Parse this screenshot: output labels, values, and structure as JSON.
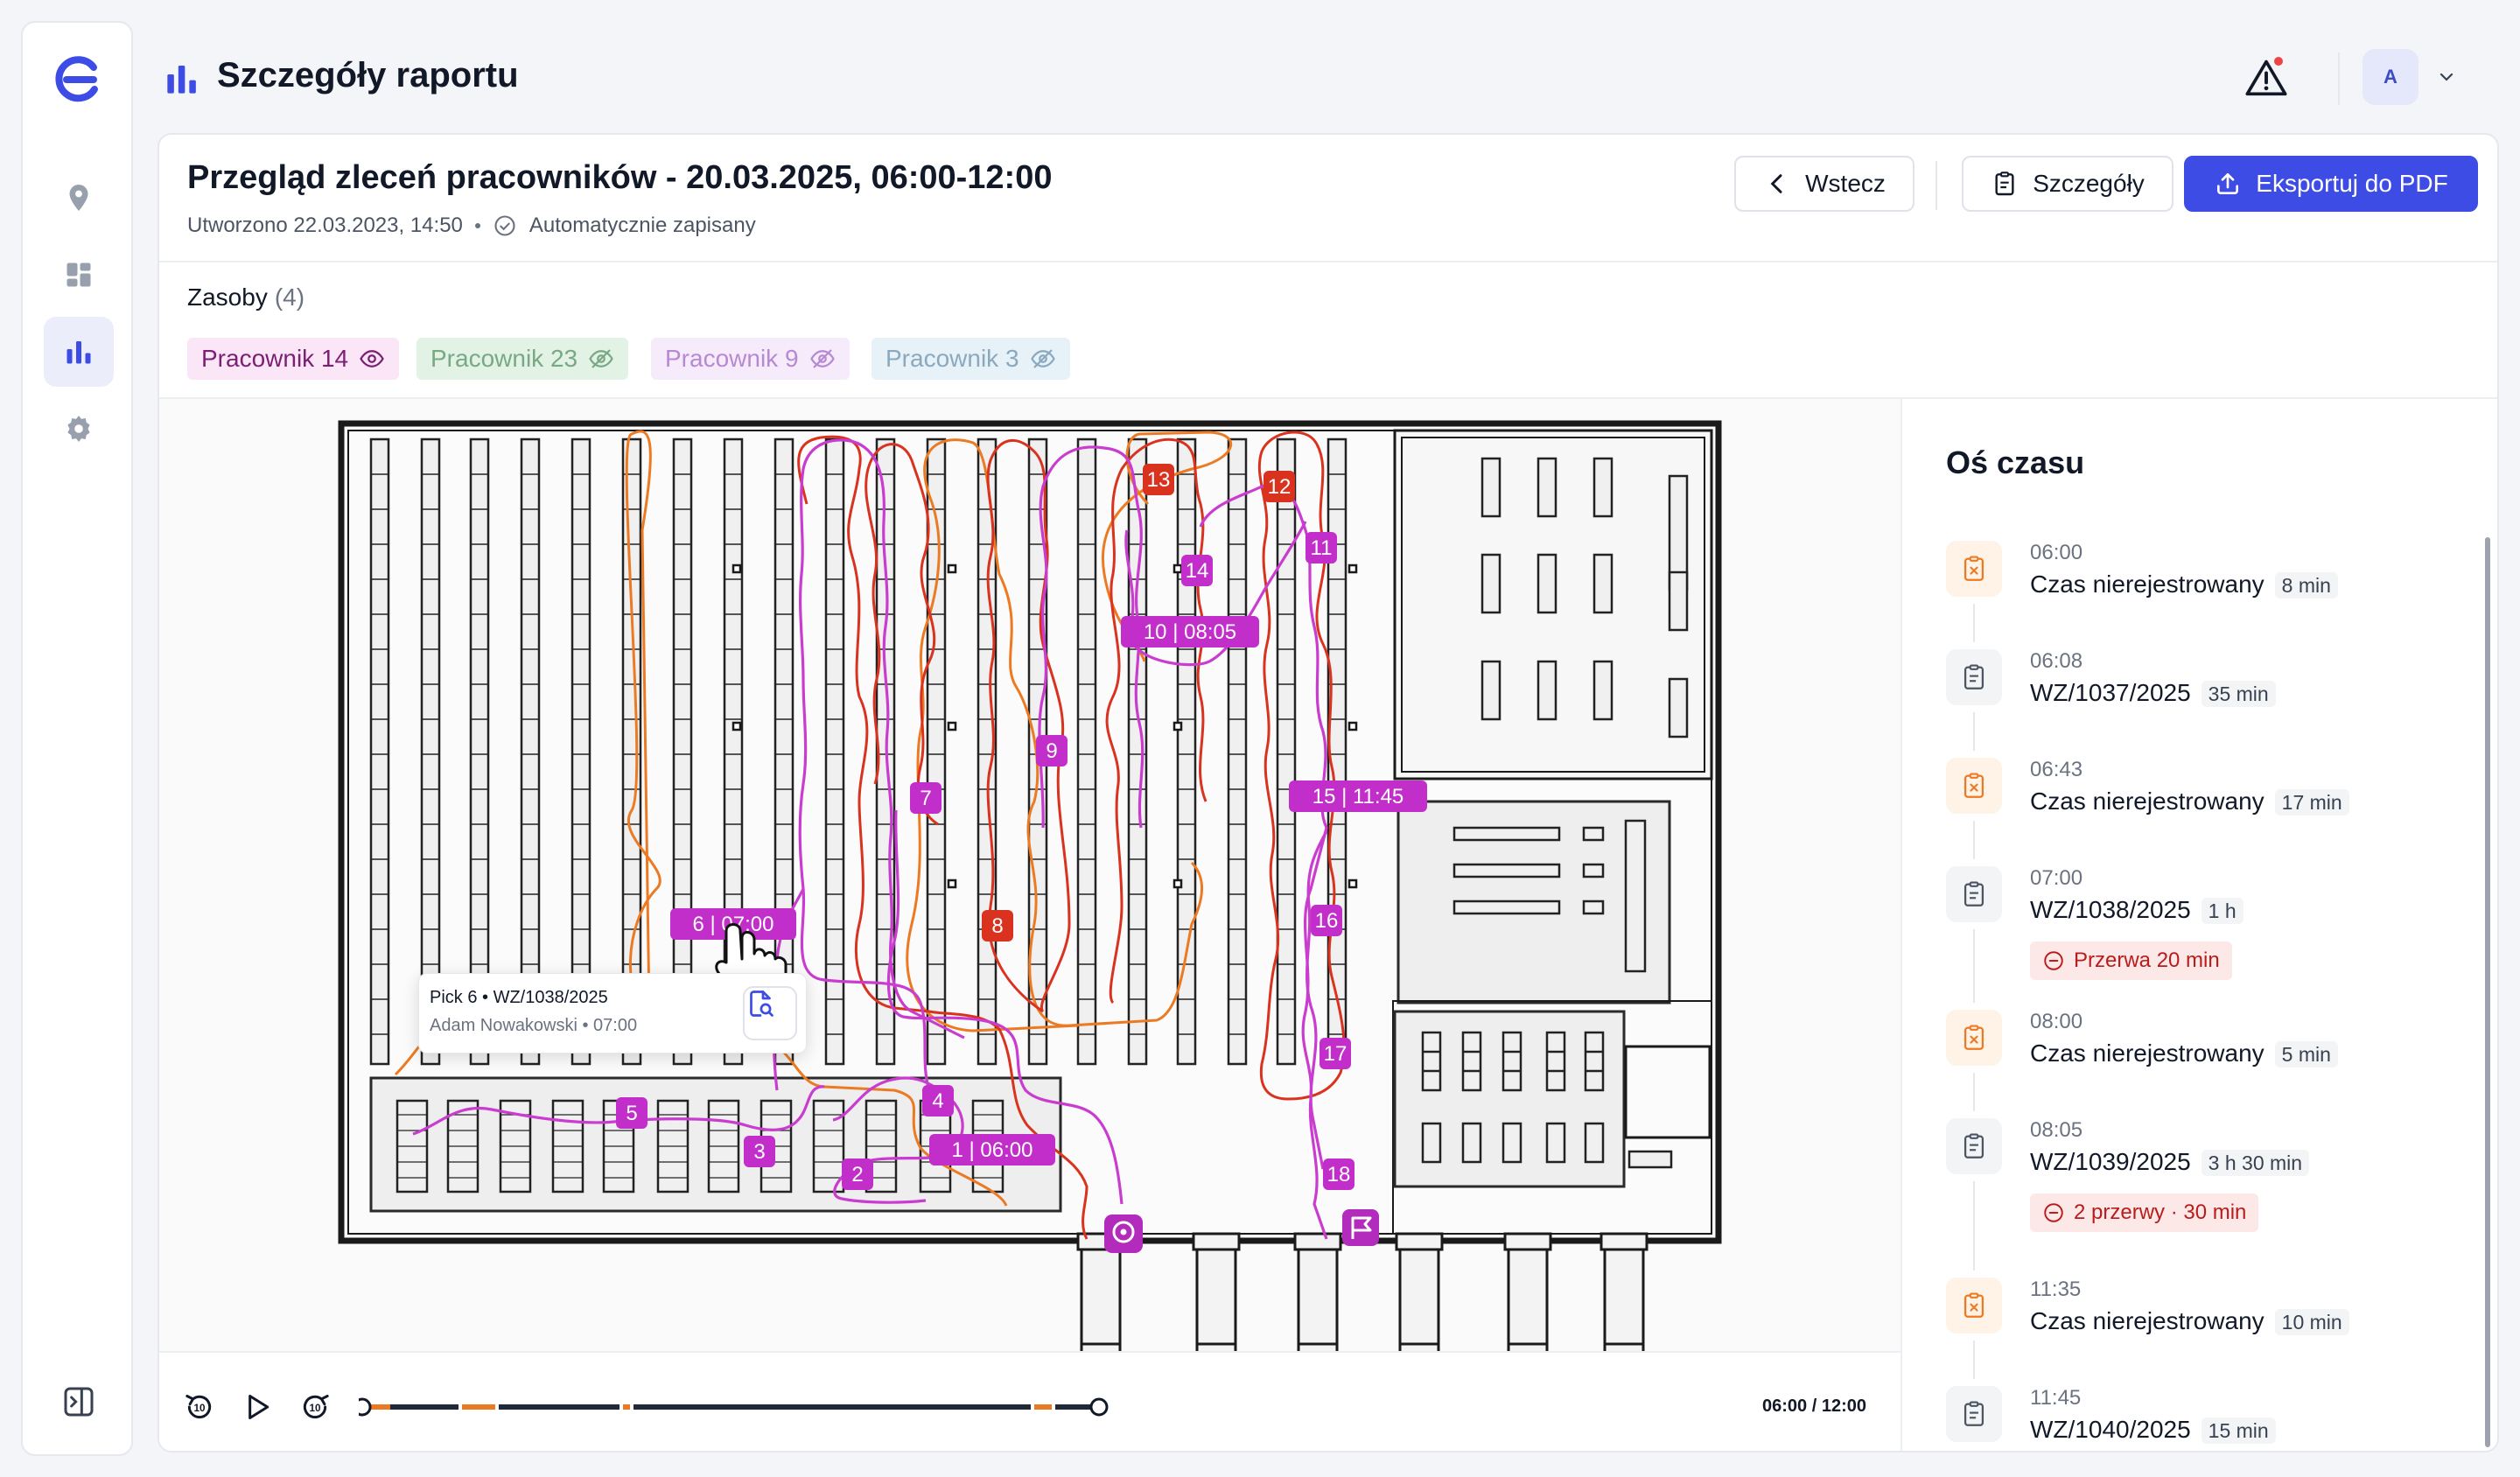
{
  "app": {
    "page_title": "Szczegóły raportu",
    "avatar_letter": "A",
    "brand_color": "#3d4ce4"
  },
  "sidebar": {
    "items": [
      {
        "icon": "location-pin-icon",
        "active": false
      },
      {
        "icon": "dashboard-grid-icon",
        "active": false
      },
      {
        "icon": "bar-chart-icon",
        "active": true
      },
      {
        "icon": "gear-icon",
        "active": false
      }
    ],
    "collapse_icon": "sidebar-collapse-icon"
  },
  "report": {
    "title": "Przegląd zleceń pracowników - 20.03.2025, 06:00-12:00",
    "created": "Utworzono 22.03.2023, 14:50",
    "autosave": "Automatycznie zapisany",
    "buttons": {
      "back": "Wstecz",
      "details": "Szczegóły",
      "export": "Eksportuj do PDF"
    }
  },
  "resources": {
    "label": "Zasoby",
    "count": "(4)",
    "chips": [
      {
        "label": "Pracownik 14",
        "visible": true,
        "bg": "#fbe6f7",
        "fg": "#7b1f73"
      },
      {
        "label": "Pracownik 23",
        "visible": false,
        "bg": "#e2f3e6",
        "fg": "#79a884"
      },
      {
        "label": "Pracownik 9",
        "visible": false,
        "bg": "#f5ebfb",
        "fg": "#b889d3"
      },
      {
        "label": "Pracownik 3",
        "visible": false,
        "bg": "#e7f1f8",
        "fg": "#8aa9bf"
      }
    ]
  },
  "map": {
    "route_colors": {
      "purple": "#c93ccf",
      "red": "#d9331f",
      "orange": "#ec7a23"
    },
    "markers": [
      {
        "label": "1 | 06:00",
        "color": "purple"
      },
      {
        "label": "2",
        "color": "purple"
      },
      {
        "label": "3",
        "color": "purple"
      },
      {
        "label": "4",
        "color": "purple"
      },
      {
        "label": "5",
        "color": "purple"
      },
      {
        "label": "6 | 07:00",
        "color": "purple"
      },
      {
        "label": "7",
        "color": "purple"
      },
      {
        "label": "8",
        "color": "red"
      },
      {
        "label": "9",
        "color": "purple"
      },
      {
        "label": "10 | 08:05",
        "color": "purple"
      },
      {
        "label": "11",
        "color": "purple"
      },
      {
        "label": "12",
        "color": "red"
      },
      {
        "label": "13",
        "color": "red"
      },
      {
        "label": "14",
        "color": "purple"
      },
      {
        "label": "15 | 11:45",
        "color": "purple"
      },
      {
        "label": "16",
        "color": "purple"
      },
      {
        "label": "17",
        "color": "purple"
      },
      {
        "label": "18",
        "color": "purple"
      }
    ],
    "tooltip": {
      "line1": "Pick 6 • WZ/1038/2025",
      "line2": "Adam Nowakowski • 07:00"
    }
  },
  "player": {
    "time": "06:00 / 12:00",
    "progress": 0
  },
  "timeline": {
    "title": "Oś czasu",
    "items": [
      {
        "time": "06:00",
        "name": "Czas nierejestrowany",
        "duration": "8 min",
        "kind": "unregistered"
      },
      {
        "time": "06:08",
        "name": "WZ/1037/2025",
        "duration": "35 min",
        "kind": "order"
      },
      {
        "time": "06:43",
        "name": "Czas nierejestrowany",
        "duration": "17 min",
        "kind": "unregistered"
      },
      {
        "time": "07:00",
        "name": "WZ/1038/2025",
        "duration": "1 h",
        "kind": "order",
        "break": "Przerwa 20 min"
      },
      {
        "time": "08:00",
        "name": "Czas nierejestrowany",
        "duration": "5 min",
        "kind": "unregistered"
      },
      {
        "time": "08:05",
        "name": "WZ/1039/2025",
        "duration": "3 h 30 min",
        "kind": "order",
        "break": "2 przerwy · 30 min"
      },
      {
        "time": "11:35",
        "name": "Czas nierejestrowany",
        "duration": "10 min",
        "kind": "unregistered"
      },
      {
        "time": "11:45",
        "name": "WZ/1040/2025",
        "duration": "15 min",
        "kind": "order"
      }
    ]
  }
}
